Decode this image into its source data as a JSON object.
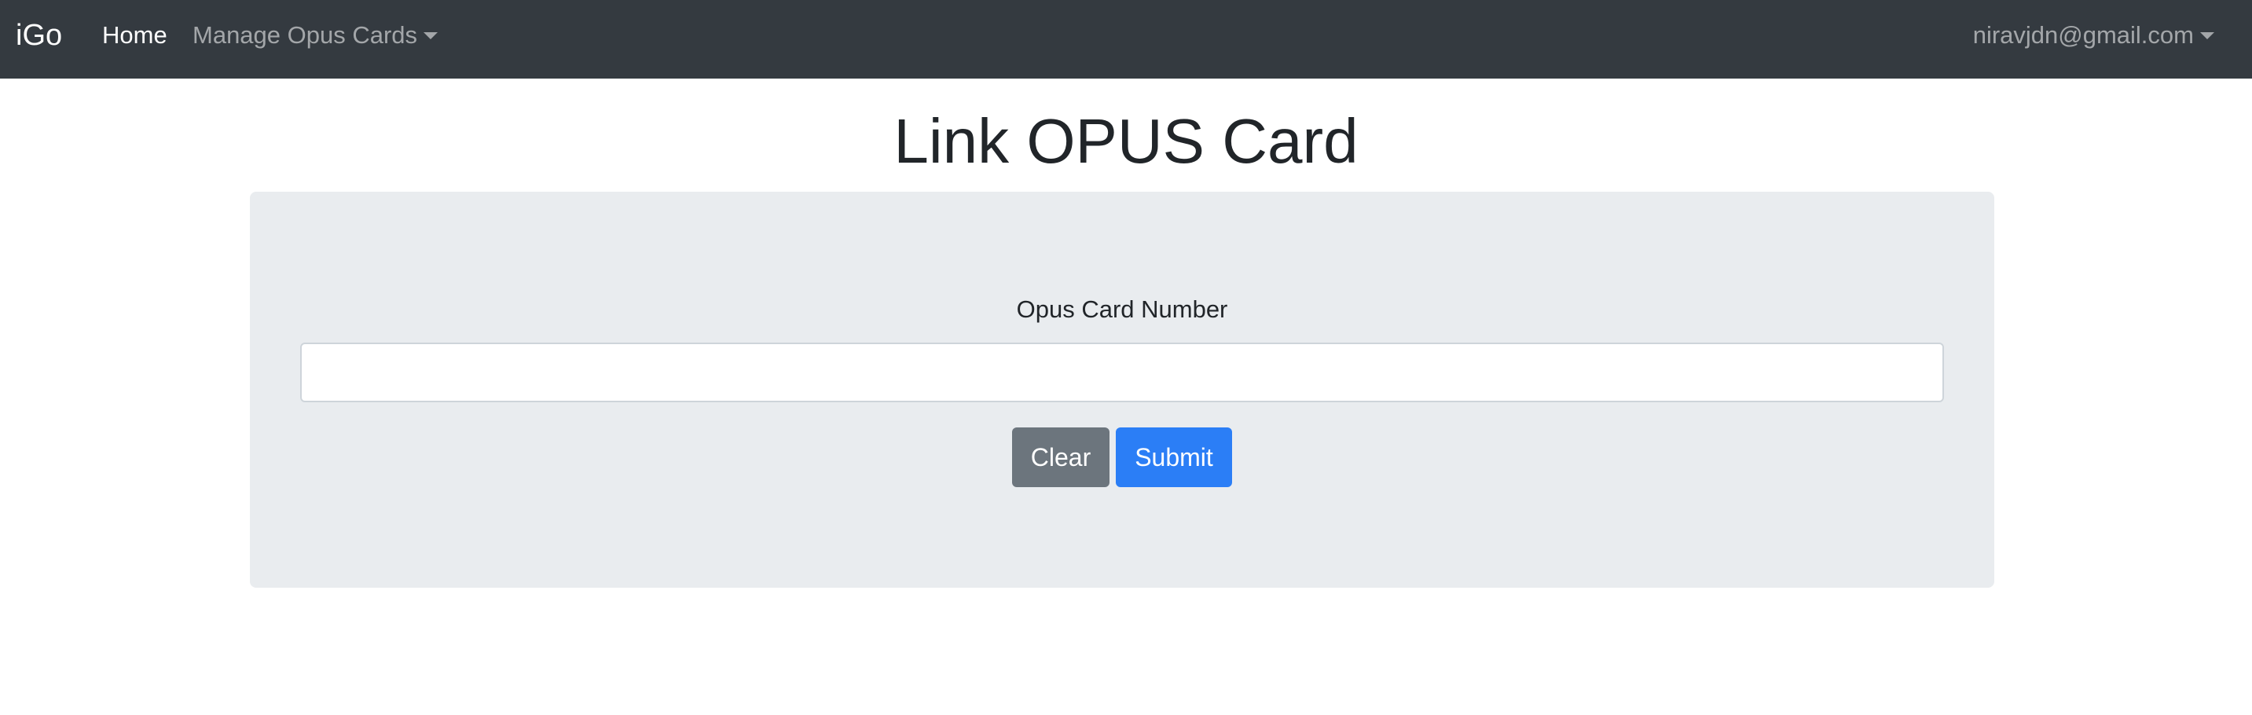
{
  "navbar": {
    "brand": "iGo",
    "home_label": "Home",
    "manage_label": "Manage Opus Cards",
    "user_email": "niravjdn@gmail.com",
    "background": "#343a40"
  },
  "main": {
    "title": "Link OPUS Card",
    "form": {
      "label": "Opus Card Number",
      "input_value": "",
      "input_placeholder": "",
      "clear_label": "Clear",
      "submit_label": "Submit"
    }
  },
  "colors": {
    "clear_button": "#6c757d",
    "submit_button": "#2b7ef6",
    "panel": "#e9ecef"
  },
  "icons": {
    "manage_dropdown": "caret-down-icon",
    "user_dropdown": "caret-down-icon"
  }
}
